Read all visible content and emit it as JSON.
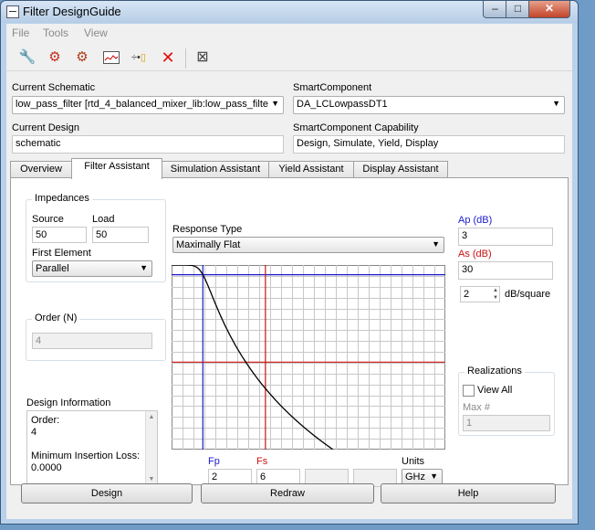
{
  "window": {
    "title": "Filter DesignGuide"
  },
  "menu": {
    "items": [
      "File",
      "Tools",
      "View"
    ]
  },
  "toolbar": {
    "icons": [
      "wrench-icon",
      "gear-red-icon",
      "gear-multi-icon",
      "chart-icon",
      "resistor-icon",
      "delete-icon",
      "grid-icon"
    ]
  },
  "current_schematic": {
    "label": "Current Schematic",
    "value": "low_pass_filter [rtd_4_balanced_mixer_lib:low_pass_filte"
  },
  "smart_component": {
    "label": "SmartComponent",
    "value": "DA_LCLowpassDT1"
  },
  "current_design": {
    "label": "Current Design",
    "value": "schematic"
  },
  "capability": {
    "label": "SmartComponent Capability",
    "value": "Design, Simulate, Yield, Display"
  },
  "tabs": [
    {
      "label": "Overview"
    },
    {
      "label": "Filter Assistant"
    },
    {
      "label": "Simulation Assistant"
    },
    {
      "label": "Yield Assistant"
    },
    {
      "label": "Display Assistant"
    }
  ],
  "impedances": {
    "title": "Impedances",
    "source_label": "Source",
    "source_value": "50",
    "load_label": "Load",
    "load_value": "50",
    "first_element_label": "First Element",
    "first_element_value": "Parallel"
  },
  "order": {
    "title": "Order (N)",
    "value": "4"
  },
  "design_info": {
    "title": "Design Information",
    "lines": [
      "Order:",
      "4",
      "",
      "Minimum Insertion Loss:",
      "0.0000"
    ]
  },
  "response": {
    "label": "Response Type",
    "value": "Maximally Flat"
  },
  "ap": {
    "label": "Ap (dB)",
    "value": "3"
  },
  "as": {
    "label": "As (dB)",
    "value": "30"
  },
  "dbsquare": {
    "value": "2",
    "label": "dB/square"
  },
  "realizations": {
    "title": "Realizations",
    "view_all_label": "View All",
    "max_label": "Max #",
    "max_value": "1"
  },
  "freq": {
    "fp_label": "Fp",
    "fp_value": "2",
    "fs_label": "Fs",
    "fs_value": "6",
    "units_label": "Units",
    "units_value": "GHz"
  },
  "buttons": {
    "design": "Design",
    "redraw": "Redraw",
    "help": "Help"
  },
  "colors": {
    "passband": "#1b1bcc",
    "stopband": "#cc1111"
  }
}
